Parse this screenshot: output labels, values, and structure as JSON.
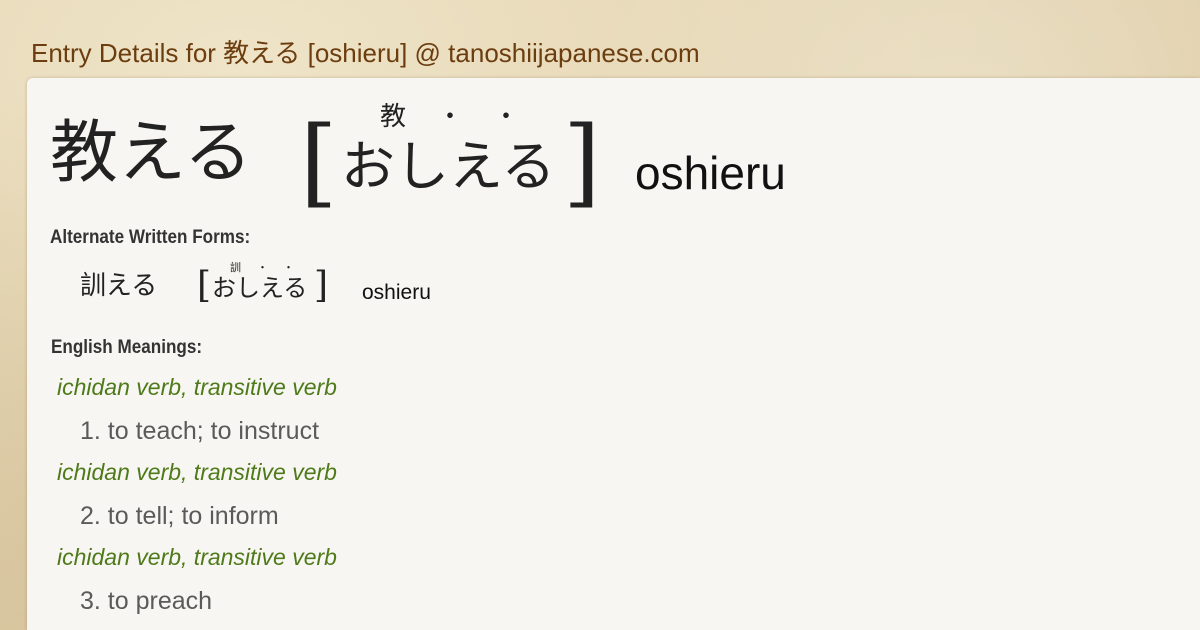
{
  "header": {
    "title": "Entry Details for 教える [oshieru] @ tanoshiijapanese.com"
  },
  "entry": {
    "word": "教える",
    "bracket_open": "[",
    "bracket_close": "]",
    "kana": "おしえる",
    "furigana": [
      "教",
      "・",
      "・"
    ],
    "romaji": "oshieru"
  },
  "alternate": {
    "heading": "Alternate Written Forms:",
    "forms": [
      {
        "word": "訓える",
        "bracket_open": "[",
        "bracket_close": "]",
        "kana": "おしえる",
        "furigana": [
          "訓",
          "・",
          "・"
        ],
        "romaji": "oshieru"
      }
    ]
  },
  "meanings": {
    "heading": "English Meanings:",
    "items": [
      {
        "pos": "ichidan verb, transitive verb",
        "text": "1. to teach; to instruct"
      },
      {
        "pos": "ichidan verb, transitive verb",
        "text": "2. to tell; to inform"
      },
      {
        "pos": "ichidan verb, transitive verb",
        "text": "3. to preach"
      }
    ]
  }
}
